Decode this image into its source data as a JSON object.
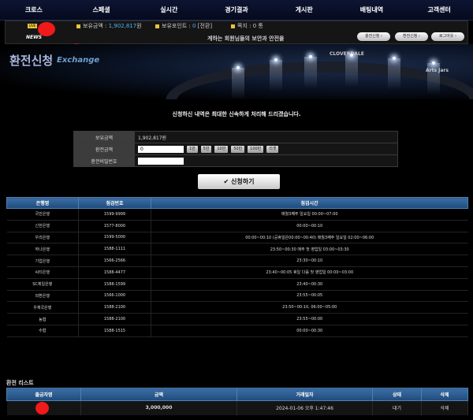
{
  "nav": {
    "items": [
      "크로스",
      "스페셜",
      "실시간",
      "경기결과",
      "게시판",
      "배팅내역",
      "고객센터"
    ]
  },
  "status": {
    "live_badge": "LIVE",
    "balance_label": "보유금액 : ",
    "balance_value": "1,902,817",
    "balance_unit": "원",
    "point_label": "보유포인트 : ",
    "point_value": "0",
    "point_action": "[전환]",
    "memo_label": "쪽지 : ",
    "memo_value": "0",
    "memo_unit": "통",
    "news_label": "NEWS",
    "ticker": "계하는 회원님들의 보안과 안전을 ",
    "buttons": [
      "충전신청",
      "환전신청",
      "로그아웃"
    ]
  },
  "hero": {
    "title": "환전신청",
    "subtitle": "Exchange",
    "ring_texts": [
      "CLOVERDALE",
      "Arts Jars"
    ]
  },
  "notice": "신청하신 내역은 최대한 신속하게 처리해 드리겠습니다.",
  "form": {
    "balance_label": "보유금액",
    "balance_value": "1,902,817원",
    "amount_label": "환전금액",
    "amount_value": "0",
    "amount_buttons": [
      "1만",
      "5만",
      "10만",
      "50만",
      "100만",
      "리셋"
    ],
    "password_label": "환전비밀번호",
    "password_value": ""
  },
  "submit": {
    "icon": "✔",
    "label": "신청하기"
  },
  "banks": {
    "headers": [
      "은행명",
      "점검번호",
      "점검시간"
    ],
    "rows": [
      [
        "국민은행",
        "1599-9999",
        "매월3째주 일요일 00:00~07:00"
      ],
      [
        "신한은행",
        "1577-8000",
        "00:00~00:10"
      ],
      [
        "우리은행",
        "1599-5000",
        "00:00~00:10 (공휴일은00:00~00:40) 매월3째주 일요일 02:00~06:00"
      ],
      [
        "하나은행",
        "1588-1111",
        "23:50~00:30 매주 첫 영업일 03:00~03:30"
      ],
      [
        "기업은행",
        "1566-2566",
        "23:30~00:10"
      ],
      [
        "씨티은행",
        "1588-4477",
        "23:40~00:05 휴일 다음 첫 영업일 00:00~03:00"
      ],
      [
        "SC제일은행",
        "1588-1599",
        "23:40~00:30"
      ],
      [
        "외환은행",
        "1566-1000",
        "23:55~00:05"
      ],
      [
        "우체국은행",
        "1588-2100",
        "23:50~00:10, 06:00~05:00"
      ],
      [
        "농협",
        "1588-2100",
        "23:55~00:00"
      ],
      [
        "수협",
        "1588-1515",
        "00:00~00:30"
      ]
    ]
  },
  "exchange_list": {
    "title": "환전 리스트",
    "headers": [
      "출금자명",
      "금액",
      "거래일자",
      "상태",
      "삭제"
    ],
    "rows": [
      [
        "",
        "3,000,000",
        "2024-01-06 오후 1:47:46",
        "대기",
        "삭제"
      ]
    ]
  }
}
